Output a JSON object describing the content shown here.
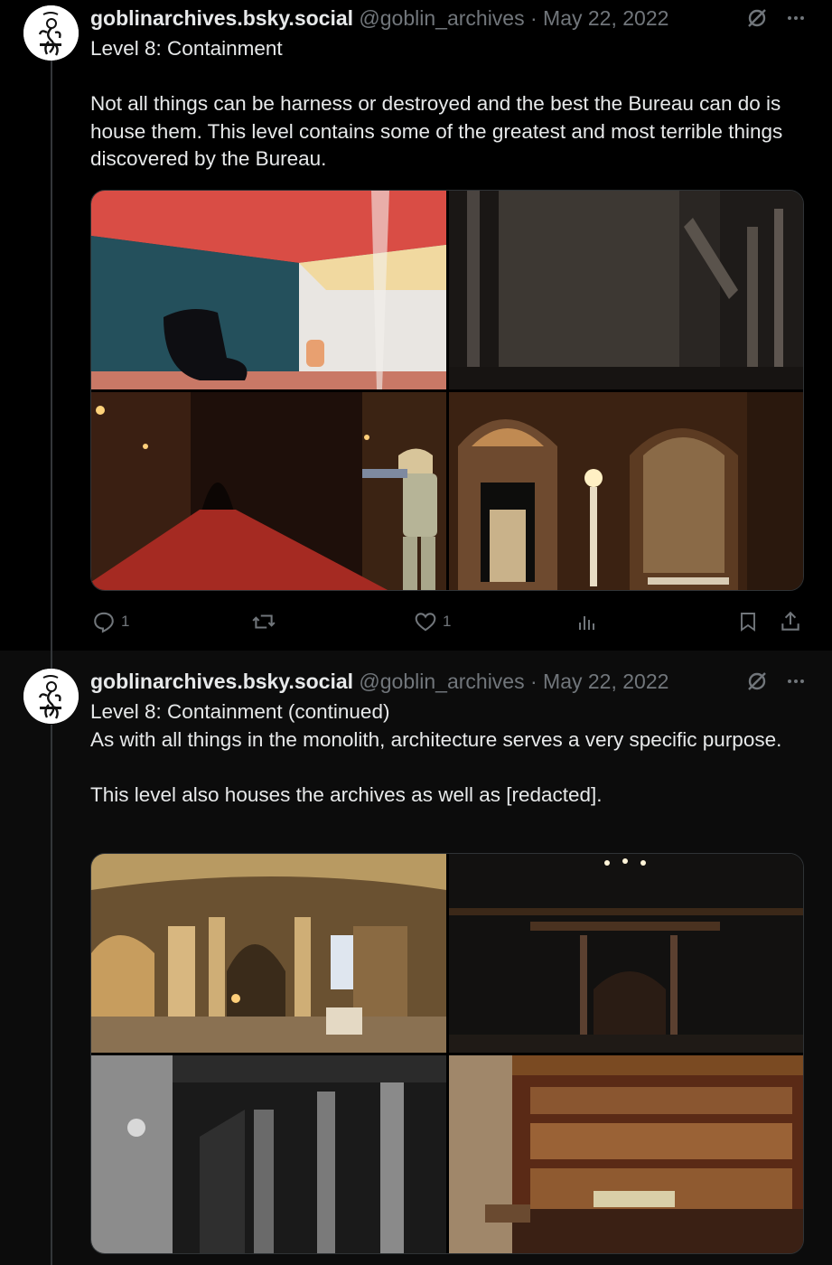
{
  "posts": [
    {
      "display_name": "goblinarchives.bsky.social",
      "handle": "@goblin_archives",
      "separator": "·",
      "date": "May 22, 2022",
      "text": "Level 8: Containment\n\nNot all things can be harness or destroyed and the best the Bureau can do is house them. This level contains some of the greatest and most terrible things discovered by the Bureau.",
      "reply_count": "1",
      "like_count": "1",
      "images": [
        "red-ceiling-room-with-chair",
        "decaying-stone-hall",
        "red-carpet-corridor-with-figure",
        "arched-marble-doorway-with-murals"
      ]
    },
    {
      "display_name": "goblinarchives.bsky.social",
      "handle": "@goblin_archives",
      "separator": "·",
      "date": "May 22, 2022",
      "text": "Level 8: Containment (continued)\nAs with all things in the monolith, architecture serves a very specific purpose.\n\nThis level also houses the archives as well as [redacted].",
      "images": [
        "grand-stone-library-hall",
        "dark-mansion-staircase",
        "gothic-pillars-interior",
        "ornate-book-library"
      ]
    }
  ],
  "colors": {
    "background": "#000000",
    "text": "#e7e9ea",
    "muted": "#71767b",
    "border": "#2f3336"
  },
  "icons": [
    "grok-icon",
    "more-icon",
    "reply-icon",
    "repost-icon",
    "like-icon",
    "views-icon",
    "bookmark-icon",
    "share-icon"
  ]
}
